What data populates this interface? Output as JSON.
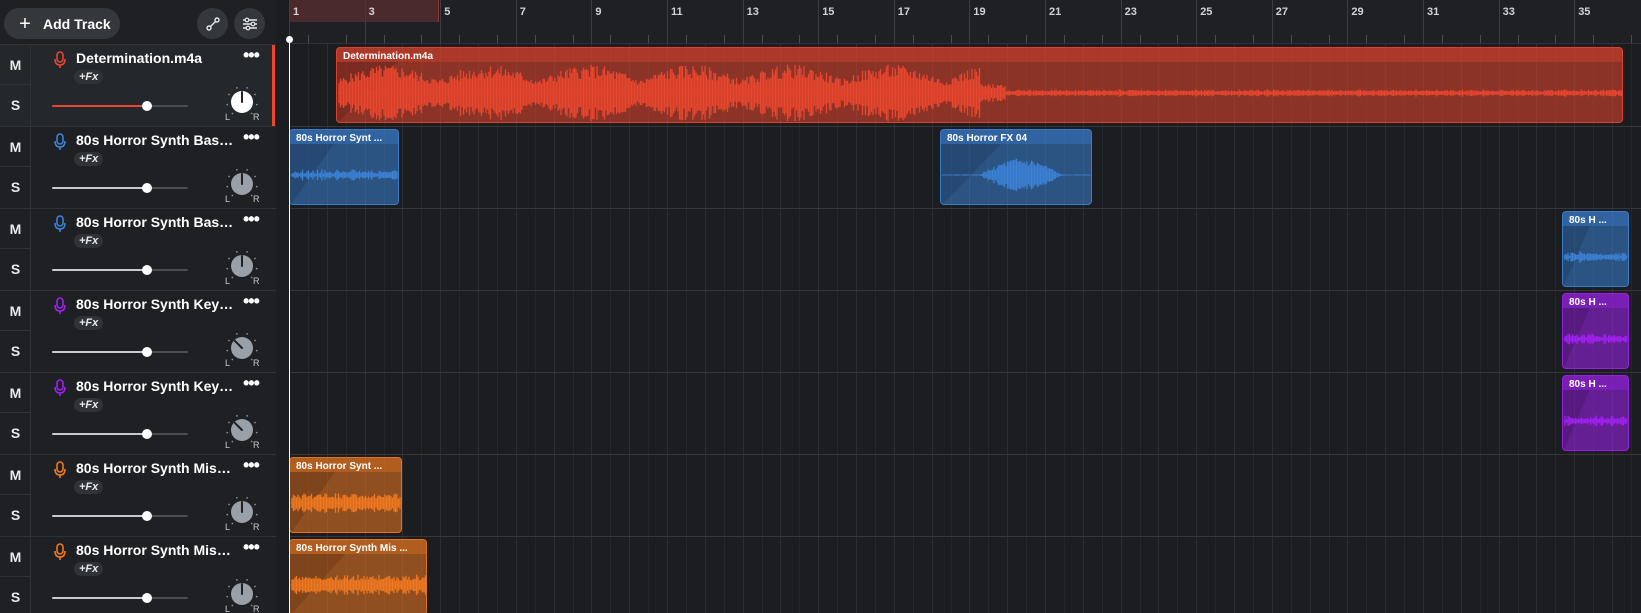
{
  "header": {
    "add_track_label": "Add Track",
    "add_track_icon": "plus-icon",
    "automation_icon": "automation-icon",
    "tempo_icon": "mixer-icon"
  },
  "ruler": {
    "bars": [
      "1",
      "3",
      "5",
      "7",
      "9",
      "11",
      "13",
      "15",
      "17",
      "19",
      "21",
      "23",
      "25",
      "27",
      "29",
      "31",
      "33",
      "35"
    ]
  },
  "colors": {
    "red": "#e8462e",
    "blue": "#3b82d6",
    "purple": "#a020f0",
    "orange": "#f07820"
  },
  "tracks": [
    {
      "mute": "M",
      "solo": "S",
      "name": "Determination.m4a",
      "fx": "+Fx",
      "color": "red",
      "volume": 0.7,
      "pan_l": "L",
      "pan_r": "R",
      "selected": true
    },
    {
      "mute": "M",
      "solo": "S",
      "name": "80s Horror Synth Bass ...",
      "fx": "+Fx",
      "color": "blue",
      "volume": 0.7,
      "pan_l": "L",
      "pan_r": "R",
      "selected": false
    },
    {
      "mute": "M",
      "solo": "S",
      "name": "80s Horror Synth Bass ...",
      "fx": "+Fx",
      "color": "blue",
      "volume": 0.7,
      "pan_l": "L",
      "pan_r": "R",
      "selected": false
    },
    {
      "mute": "M",
      "solo": "S",
      "name": "80s Horror Synth Keys ...",
      "fx": "+Fx",
      "color": "purple",
      "volume": 0.7,
      "pan_l": "L",
      "pan_r": "R",
      "selected": false
    },
    {
      "mute": "M",
      "solo": "S",
      "name": "80s Horror Synth Keys ...",
      "fx": "+Fx",
      "color": "purple",
      "volume": 0.7,
      "pan_l": "L",
      "pan_r": "R",
      "selected": false
    },
    {
      "mute": "M",
      "solo": "S",
      "name": "80s Horror Synth Misc ...",
      "fx": "+Fx",
      "color": "orange",
      "volume": 0.7,
      "pan_l": "L",
      "pan_r": "R",
      "selected": false
    },
    {
      "mute": "M",
      "solo": "S",
      "name": "80s Horror Synth Misc ...",
      "fx": "+Fx",
      "color": "orange",
      "volume": 0.7,
      "pan_l": "L",
      "pan_r": "R",
      "selected": false
    }
  ],
  "clips": [
    {
      "title": "Determination.m4a",
      "track": 0,
      "color": "red"
    },
    {
      "title": "80s Horror Synt ...",
      "track": 1,
      "color": "blue"
    },
    {
      "title": "80s Horror FX 04",
      "track": 1,
      "color": "blue"
    },
    {
      "title": "80s H ...",
      "track": 2,
      "color": "blue"
    },
    {
      "title": "80s H ...",
      "track": 3,
      "color": "purple"
    },
    {
      "title": "80s H ...",
      "track": 4,
      "color": "purple"
    },
    {
      "title": "80s Horror Synt ...",
      "track": 5,
      "color": "orange"
    },
    {
      "title": "80s Horror Synth Mis ...",
      "track": 6,
      "color": "orange"
    }
  ]
}
